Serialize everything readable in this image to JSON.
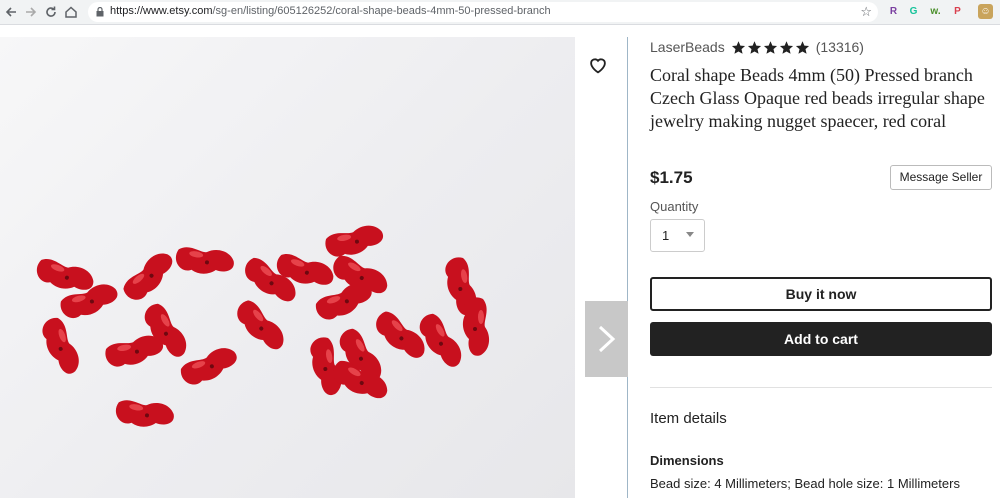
{
  "browser": {
    "url_host": "https://www.etsy.com",
    "url_path": "/sg-en/listing/605126252/coral-shape-beads-4mm-50-pressed-branch",
    "extensions": [
      {
        "name": "r-extension-icon",
        "glyph": "R",
        "color": "#7b3fa0"
      },
      {
        "name": "grammarly-icon",
        "glyph": "G",
        "color": "#15c39a"
      },
      {
        "name": "w-extension-icon",
        "glyph": "w.",
        "color": "#4a8f2a"
      },
      {
        "name": "pocket-icon",
        "glyph": "P",
        "color": "#d93f4e"
      }
    ]
  },
  "listing": {
    "shop_name": "LaserBeads",
    "rating_stars": 5,
    "rating_count": "(13316)",
    "title": "Coral shape Beads 4mm (50) Pressed branch Czech Glass Opaque red beads irregular shape jewelry making nugget spaecer, red coral",
    "price": "$1.75",
    "message_seller_label": "Message Seller",
    "quantity_label": "Quantity",
    "quantity_value": "1",
    "buy_now_label": "Buy it now",
    "add_to_cart_label": "Add to cart"
  },
  "details": {
    "heading": "Item details",
    "dimensions_heading": "Dimensions",
    "dimensions_text": "Bead size: 4 Millimeters; Bead hole size: 1 Millimeters"
  },
  "colors": {
    "bead_red": "#c8101e",
    "button_dark": "#222222"
  }
}
